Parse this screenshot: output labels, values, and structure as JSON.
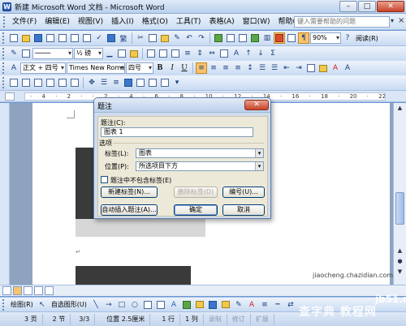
{
  "window": {
    "title": "新建 Microsoft Word 文档 - Microsoft Word"
  },
  "menu": {
    "items": [
      "文件(F)",
      "编辑(E)",
      "视图(V)",
      "插入(I)",
      "格式(O)",
      "工具(T)",
      "表格(A)",
      "窗口(W)",
      "帮助(H)"
    ],
    "help_placeholder": "键入需要帮助的问题"
  },
  "toolbar1": {
    "zoom": "90%",
    "reading": "阅读(R)"
  },
  "toolbar2": {
    "line_weight": "½ 磅"
  },
  "format_toolbar": {
    "style": "正文 + 四号",
    "font": "Times New Roman",
    "size": "四号",
    "bold": "B",
    "italic": "I",
    "underline": "U"
  },
  "dialog": {
    "title": "题注",
    "caption_label": "题注(C):",
    "caption_value": "图表 1",
    "options_label": "选项",
    "label_label": "标签(L):",
    "label_value": "图表",
    "position_label": "位置(P):",
    "position_value": "所选项目下方",
    "exclude_label": "题注中不包含标签(E)",
    "new_label_btn": "新建标签(N)...",
    "delete_label_btn": "删除标签(D)",
    "numbering_btn": "编号(U)...",
    "autocaption_btn": "自动插入题注(A)...",
    "ok_btn": "确定",
    "cancel_btn": "取消"
  },
  "drawing": {
    "draw_label": "绘图(R)",
    "autoshapes_label": "自选图形(U)"
  },
  "status": {
    "page": "3 页",
    "section": "2 节",
    "pages": "3/3",
    "position": "位置 2.5厘米",
    "line": "1 行",
    "col": "1 列",
    "rec": "录制",
    "trk": "修订",
    "ext": "扩展"
  },
  "watermark": {
    "site": "jb51.net",
    "name": "查字典 教程网",
    "url": "jiaocheng.chazidian.com"
  },
  "colors": {
    "accent": "#3b76c9",
    "active_button": "#f9c46b",
    "dialog_close": "#c8432a"
  }
}
